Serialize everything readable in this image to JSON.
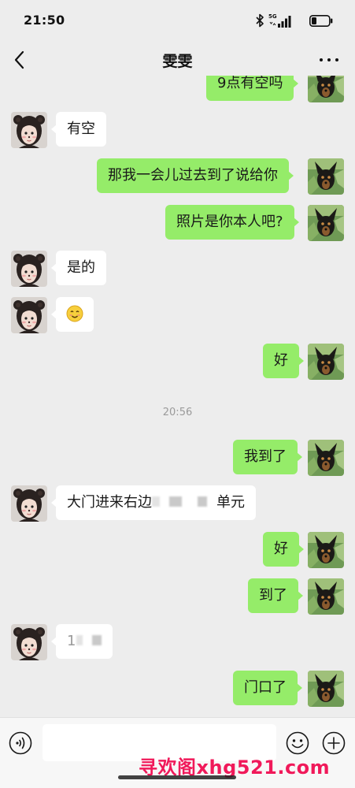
{
  "status_bar": {
    "time": "21:50",
    "network": "5G",
    "icons": [
      "bluetooth-icon",
      "signal-icon",
      "battery-icon"
    ]
  },
  "header": {
    "title": "雯雯",
    "back_icon": "chevron-left-icon",
    "more_icon": "ellipsis-icon"
  },
  "chat": {
    "timestamp": "20:56",
    "messages": [
      {
        "side": "sent",
        "text": "9点有空吗"
      },
      {
        "side": "received",
        "text": "有空"
      },
      {
        "side": "sent",
        "text": "那我一会儿过去到了说给你"
      },
      {
        "side": "sent",
        "text": "照片是你本人吧?"
      },
      {
        "side": "received",
        "text": "是的"
      },
      {
        "side": "received",
        "emoji": "smile-emoji"
      },
      {
        "side": "sent",
        "text": "好"
      },
      {
        "side": "sent",
        "text": "我到了"
      },
      {
        "side": "received",
        "text_start": "大门进来右边",
        "text_end": "单元",
        "redacted": true
      },
      {
        "side": "sent",
        "text": "好"
      },
      {
        "side": "sent",
        "text": "到了"
      },
      {
        "side": "received",
        "text_start": "1",
        "redacted": true
      },
      {
        "side": "sent",
        "text": "门口了"
      }
    ]
  },
  "input_bar": {
    "voice_icon": "voice-icon",
    "emoji_icon": "emoji-icon",
    "plus_icon": "plus-icon",
    "value": ""
  },
  "watermark": "寻欢阁xhg521.com",
  "colors": {
    "background": "#ededed",
    "sent_bubble": "#95ec69",
    "received_bubble": "#ffffff",
    "watermark": "#f0195a"
  }
}
